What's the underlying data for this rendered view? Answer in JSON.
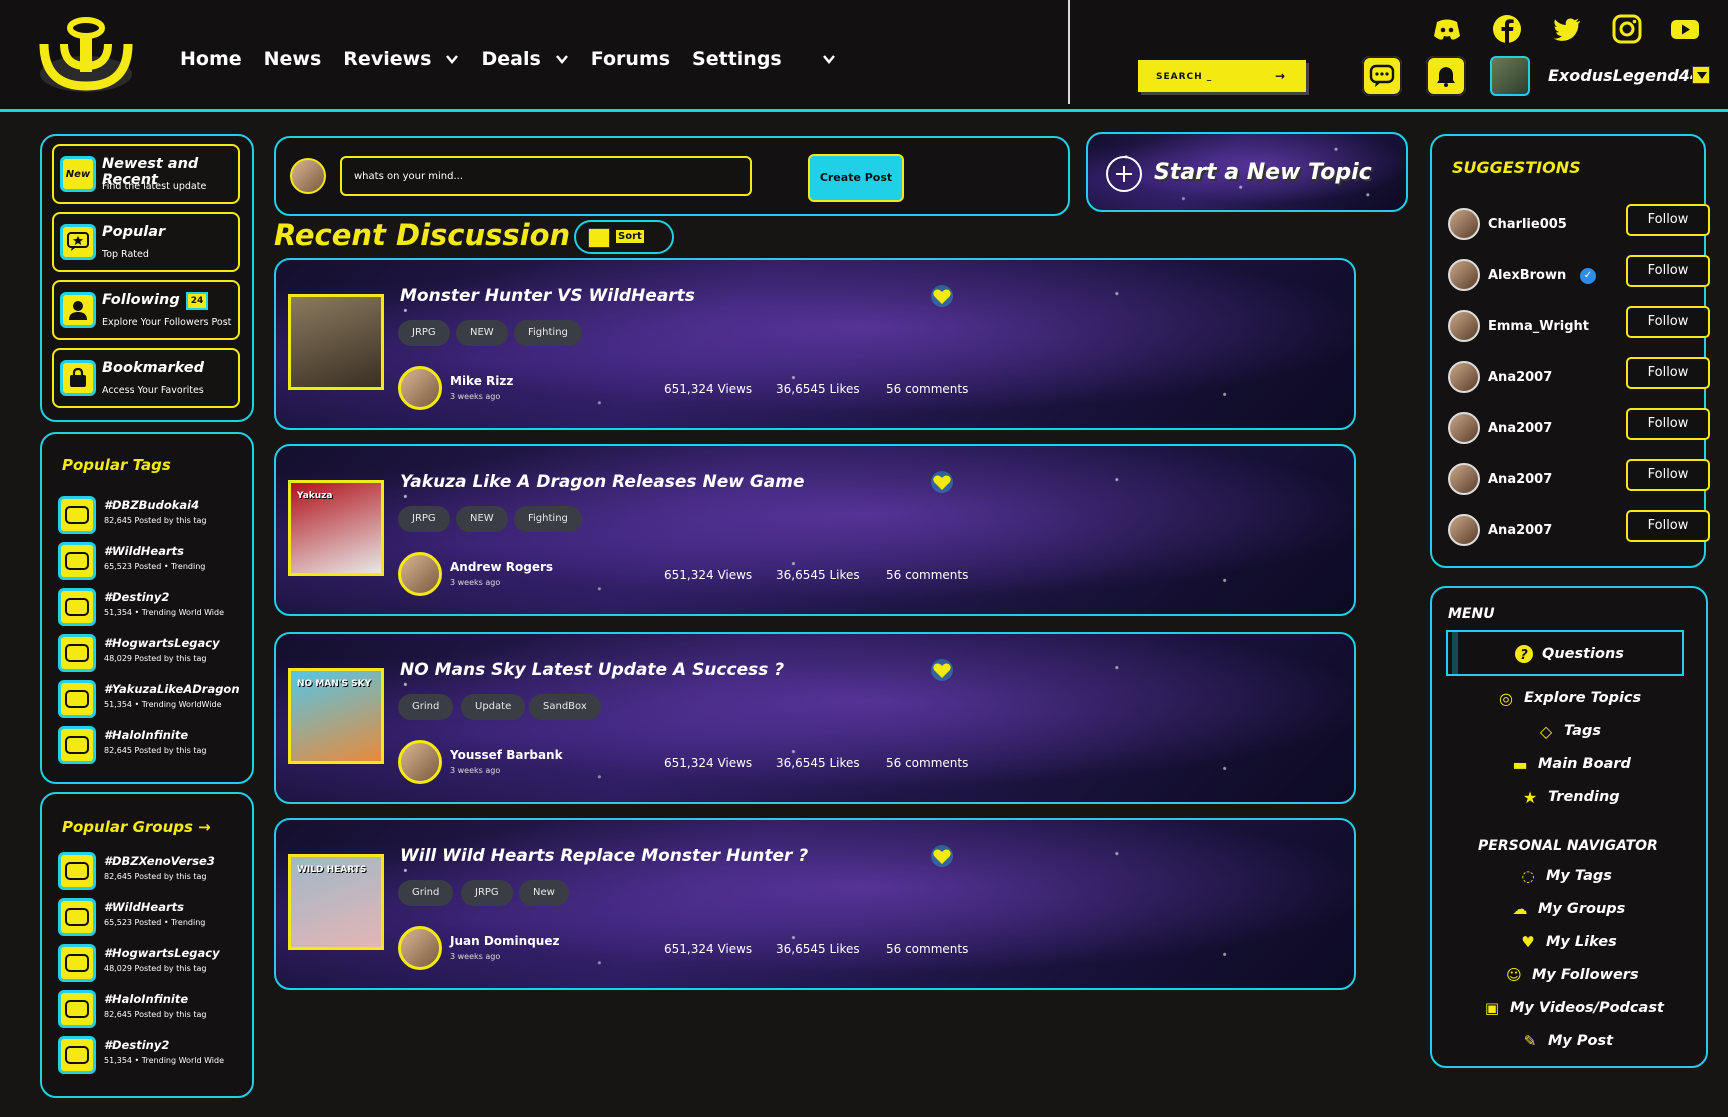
{
  "header": {
    "nav": [
      {
        "label": "Home",
        "dropdown": false
      },
      {
        "label": "News",
        "dropdown": false
      },
      {
        "label": "Reviews",
        "dropdown": true
      },
      {
        "label": "Deals",
        "dropdown": true
      },
      {
        "label": "Forums",
        "dropdown": false
      },
      {
        "label": "Settings",
        "dropdown": true
      }
    ],
    "search_placeholder": "SEARCH _",
    "username": "ExodusLegend44",
    "social_icons": [
      "discord-icon",
      "facebook-icon",
      "twitter-icon",
      "instagram-icon",
      "youtube-icon"
    ]
  },
  "left_nav": {
    "items": [
      {
        "title": "Newest and Recent",
        "subtitle": "Find the latest update",
        "badge": "New"
      },
      {
        "title": "Popular",
        "subtitle": "Top Rated"
      },
      {
        "title": "Following",
        "subtitle": "Explore Your Followers Post",
        "count": "24"
      },
      {
        "title": "Bookmarked",
        "subtitle": "Access Your Favorites"
      }
    ]
  },
  "popular_tags": {
    "title": "Popular Tags",
    "items": [
      {
        "name": "#DBZBudokai4",
        "sub": "82,645 Posted by this tag"
      },
      {
        "name": "#WildHearts",
        "sub": "65,523 Posted • Trending"
      },
      {
        "name": "#Destiny2",
        "sub": "51,354 • Trending World Wide"
      },
      {
        "name": "#HogwartsLegacy",
        "sub": "48,029 Posted by this tag"
      },
      {
        "name": "#YakuzaLikeADragon",
        "sub": "51,354 • Trending WorldWide"
      },
      {
        "name": "#HaloInfinite",
        "sub": "82,645 Posted by this tag"
      }
    ]
  },
  "popular_groups": {
    "title": "Popular Groups →",
    "items": [
      {
        "name": "#DBZXenoVerse3",
        "sub": "82,645 Posted by this tag"
      },
      {
        "name": "#WildHearts",
        "sub": "65,523 Posted • Trending"
      },
      {
        "name": "#HogwartsLegacy",
        "sub": "48,029 Posted by this tag"
      },
      {
        "name": "#HaloInfinite",
        "sub": "82,645 Posted by this tag"
      },
      {
        "name": "#Destiny2",
        "sub": "51,354 • Trending World Wide"
      }
    ]
  },
  "composer": {
    "placeholder": "whats on your mind...",
    "create_label": "Create Post"
  },
  "new_topic_label": "Start a New Topic",
  "feed": {
    "title": "Recent Discussion",
    "sort_label": "Sort",
    "posts": [
      {
        "title": "Monster Hunter VS WildHearts",
        "tags": [
          "JRPG",
          "NEW",
          "Fighting"
        ],
        "author": "Mike Rizz",
        "time": "3 weeks ago",
        "views": "651,324 Views",
        "likes": "36,6545 Likes",
        "comments": "56 comments",
        "thumb_colors": [
          "#8a7a5e",
          "#3a2f24"
        ]
      },
      {
        "title": "Yakuza Like A Dragon Releases New Game",
        "tags": [
          "JRPG",
          "NEW",
          "Fighting"
        ],
        "author": "Andrew Rogers",
        "time": "3 weeks ago",
        "views": "651,324 Views",
        "likes": "36,6545 Likes",
        "comments": "56 comments",
        "thumb_colors": [
          "#b0141c",
          "#e8e8e8"
        ],
        "thumb_text": "Yakuza"
      },
      {
        "title": "NO Mans Sky Latest Update A Success ?",
        "tags": [
          "Grind",
          "Update",
          "SandBox"
        ],
        "author": "Youssef Barbank",
        "time": "3 weeks ago",
        "views": "651,324 Views",
        "likes": "36,6545 Likes",
        "comments": "56 comments",
        "thumb_colors": [
          "#55c6e8",
          "#e88a3a"
        ],
        "thumb_text": "NO MAN'S SKY"
      },
      {
        "title": "Will Wild Hearts Replace Monster Hunter ?",
        "tags": [
          "Grind",
          "JRPG",
          "New"
        ],
        "author": "Juan Dominquez",
        "time": "3 weeks ago",
        "views": "651,324 Views",
        "likes": "36,6545 Likes",
        "comments": "56 comments",
        "thumb_colors": [
          "#9fb8c8",
          "#e4b5b5"
        ],
        "thumb_text": "WILD HEARTS"
      }
    ]
  },
  "suggestions": {
    "title": "SUGGESTIONS",
    "follow_label": "Follow",
    "users": [
      {
        "name": "Charlie005",
        "verified": false
      },
      {
        "name": "AlexBrown",
        "verified": true
      },
      {
        "name": "Emma_Wright",
        "verified": false
      },
      {
        "name": "Ana2007",
        "verified": false
      },
      {
        "name": "Ana2007",
        "verified": false
      },
      {
        "name": "Ana2007",
        "verified": false
      },
      {
        "name": "Ana2007",
        "verified": false
      }
    ]
  },
  "menu": {
    "title": "MENU",
    "active": "Questions",
    "items": [
      "Explore Topics",
      "Tags",
      "Main Board",
      "Trending"
    ],
    "personal_title": "PERSONAL NAVIGATOR",
    "personal_items": [
      "My Tags",
      "My Groups",
      "My Likes",
      "My Followers",
      "My Videos/Podcast",
      "My Post"
    ]
  },
  "colors": {
    "accent": "#f4ea12",
    "border": "#1fd0e6",
    "background": "#171414"
  }
}
